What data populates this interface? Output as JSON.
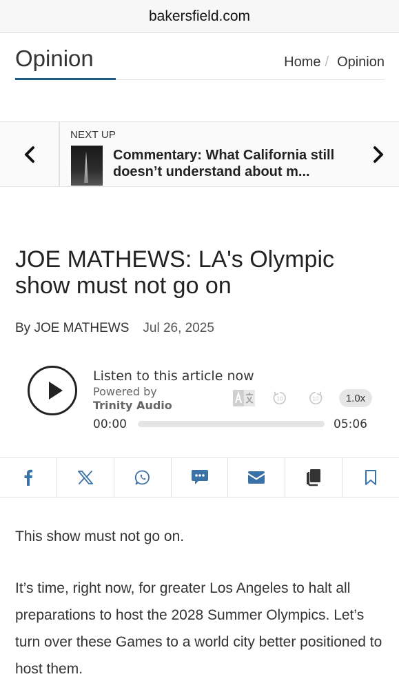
{
  "browser": {
    "url": "bakersfield.com"
  },
  "section": {
    "title": "Opinion",
    "accent_color": "#1d5c86"
  },
  "breadcrumb": {
    "home": "Home",
    "separator": "/",
    "current": "Opinion"
  },
  "next_up": {
    "label": "NEXT UP",
    "headline": "Commentary: What California still doesn’t understand about m..."
  },
  "article": {
    "title": "JOE MATHEWS: LA's Olympic show must not go on",
    "byline": "By JOE MATHEWS",
    "date": "Jul 26, 2025",
    "paragraphs": [
      "This show must not go on.",
      "It’s time, right now, for greater Los Angeles to halt all preparations to host the 2028 Summer Olympics. Let’s turn over these Games to a world city better positioned to host them."
    ]
  },
  "audio": {
    "listen_text": "Listen to this article now",
    "powered_by": "Powered by",
    "provider": "Trinity Audio",
    "skip_back": "10",
    "skip_forward": "10",
    "speed": "1.0x",
    "current_time": "00:00",
    "duration": "05:06",
    "progress_fraction": 0
  },
  "share": {
    "icons": [
      "facebook-icon",
      "x-icon",
      "whatsapp-icon",
      "sms-icon",
      "email-icon",
      "copy-icon",
      "bookmark-icon"
    ],
    "brand_color": "#3a72a8"
  }
}
